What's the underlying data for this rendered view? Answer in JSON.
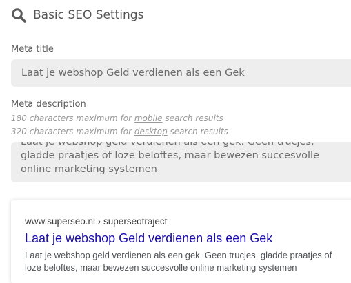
{
  "header": {
    "title": "Basic SEO Settings",
    "icon": "search-icon"
  },
  "meta_title": {
    "label": "Meta title",
    "value": "Laat je webshop Geld verdienen als een Gek"
  },
  "meta_description": {
    "label": "Meta description",
    "hint_mobile": {
      "pre": "180 characters maximum for ",
      "link": "mobile",
      "post": " search results"
    },
    "hint_desktop": {
      "pre": "320 characters maximum for ",
      "link": "desktop",
      "post": " search results"
    },
    "value": "Laat je webshop geld verdienen als een gek. Geen trucjes, gladde praatjes of loze beloftes, maar bewezen succesvolle online marketing systemen"
  },
  "preview": {
    "url": "www.superseo.nl › superseotraject",
    "title": "Laat je webshop Geld verdienen als een Gek",
    "description": "Laat je webshop geld verdienen als een gek. Geen trucjes, gladde praatjes of loze beloftes, maar bewezen succesvolle online marketing systemen"
  },
  "colors": {
    "link": "#1a0dab",
    "field_bg": "#eeeeee",
    "text": "#555555"
  }
}
